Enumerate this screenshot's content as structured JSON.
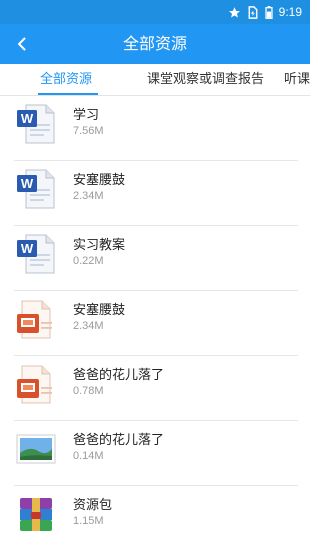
{
  "status_bar": {
    "time": "9:19",
    "icons": [
      "star-icon",
      "sim-icon",
      "battery-icon"
    ]
  },
  "header": {
    "title": "全部资源",
    "back_icon": "back-arrow-icon"
  },
  "tabs": [
    {
      "label": "全部资源",
      "active": true
    },
    {
      "label": "课堂观察或调查报告",
      "active": false
    },
    {
      "label": "听课",
      "active": false
    }
  ],
  "files": [
    {
      "name": "学习",
      "size": "7.56M",
      "type": "word"
    },
    {
      "name": "安塞腰鼓",
      "size": "2.34M",
      "type": "word"
    },
    {
      "name": "实习教案",
      "size": "0.22M",
      "type": "word"
    },
    {
      "name": "安塞腰鼓",
      "size": "2.34M",
      "type": "ppt"
    },
    {
      "name": "爸爸的花儿落了",
      "size": "0.78M",
      "type": "ppt"
    },
    {
      "name": "爸爸的花儿落了",
      "size": "0.14M",
      "type": "image"
    },
    {
      "name": "资源包",
      "size": "1.15M",
      "type": "archive"
    }
  ],
  "colors": {
    "primary": "#2196f3",
    "status_bar": "#1e8fe1",
    "secondary_text": "#9a9a9a"
  }
}
